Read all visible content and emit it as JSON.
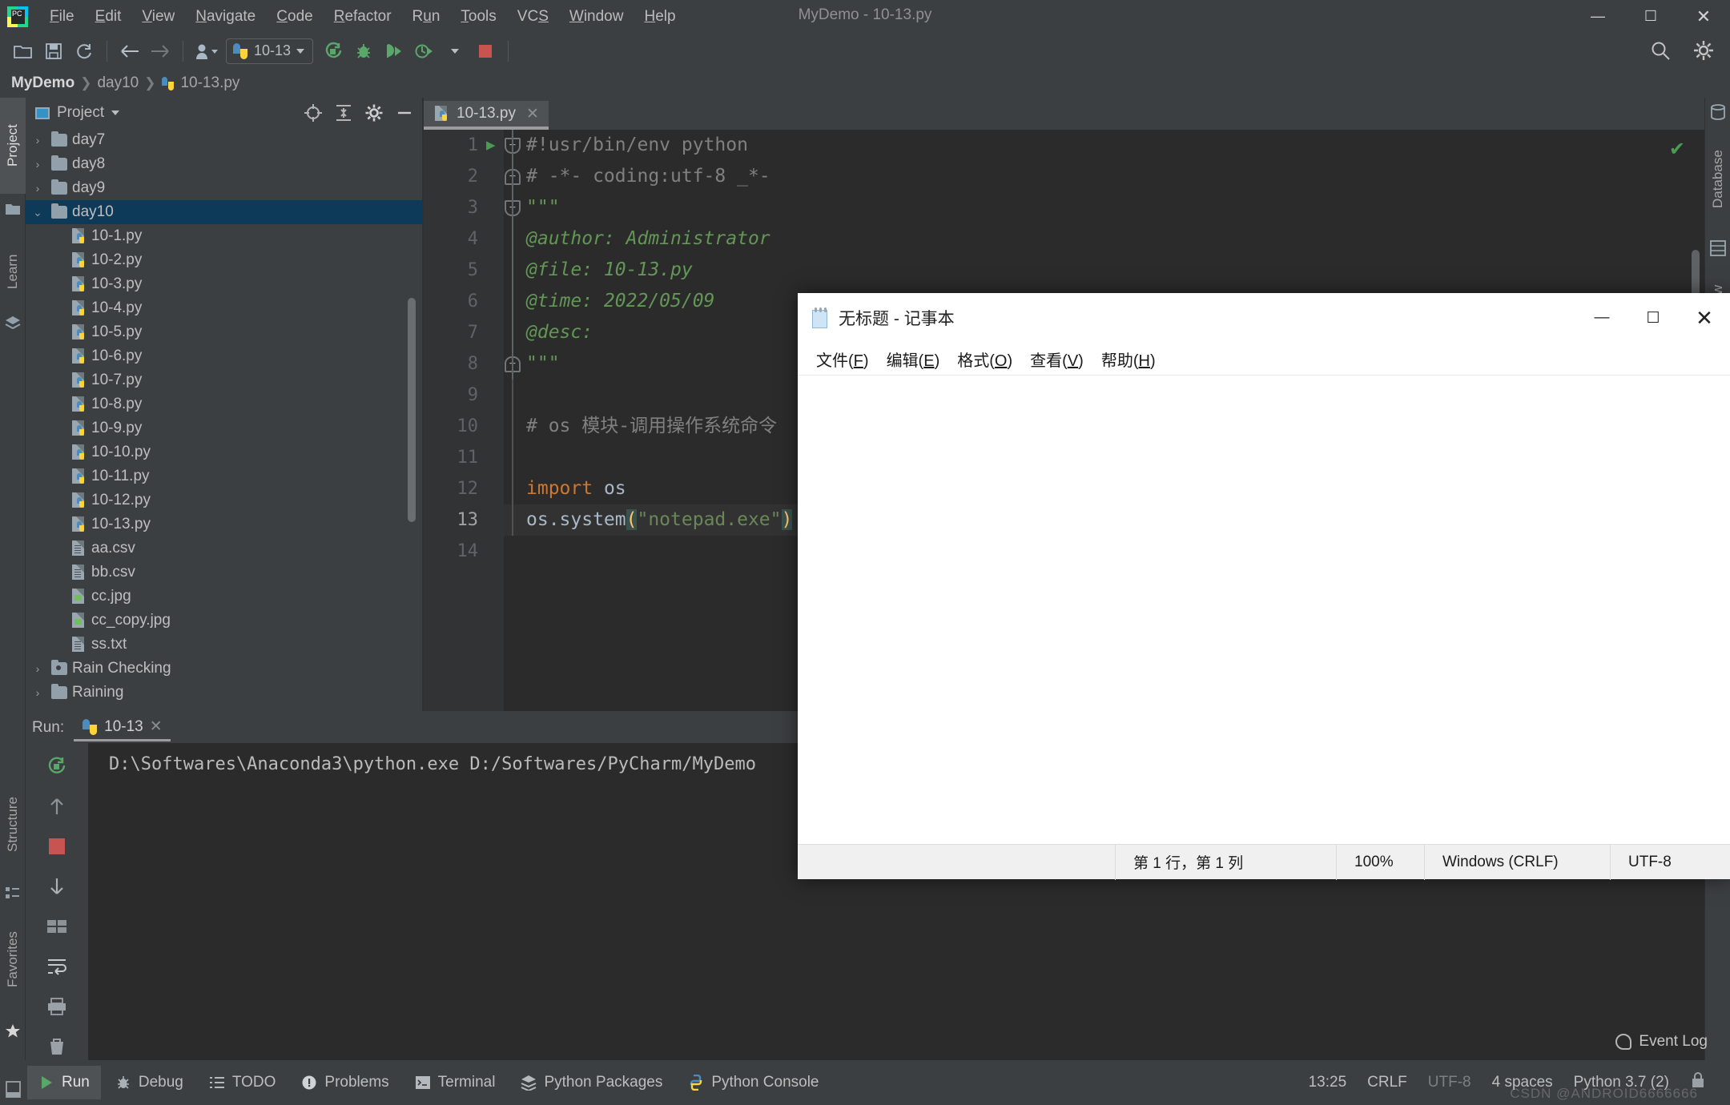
{
  "window": {
    "title": "MyDemo - 10-13.py",
    "minimize": "—",
    "maximize": "☐",
    "close": "✕"
  },
  "menubar": [
    {
      "label": "File",
      "mnemonic": "F"
    },
    {
      "label": "Edit",
      "mnemonic": "E"
    },
    {
      "label": "View",
      "mnemonic": "V"
    },
    {
      "label": "Navigate",
      "mnemonic": "N"
    },
    {
      "label": "Code",
      "mnemonic": "C"
    },
    {
      "label": "Refactor",
      "mnemonic": "R"
    },
    {
      "label": "Run",
      "mnemonic": "u"
    },
    {
      "label": "Tools",
      "mnemonic": "T"
    },
    {
      "label": "VCS",
      "mnemonic": "S"
    },
    {
      "label": "Window",
      "mnemonic": "W"
    },
    {
      "label": "Help",
      "mnemonic": "H"
    }
  ],
  "toolbar": {
    "open_icon": "open-folder-icon",
    "save_icon": "save-icon",
    "sync_icon": "sync-icon",
    "back_icon": "back-arrow-icon",
    "forward_icon": "forward-arrow-icon",
    "profile_icon": "user-icon",
    "run_config": "10-13",
    "run_icon": "run-icon",
    "debug_icon": "debug-icon",
    "coverage_icon": "run-coverage-icon",
    "profile_run_icon": "profile-icon",
    "stop_icon": "stop-icon",
    "search_icon": "search-icon",
    "settings_icon": "gear-icon"
  },
  "breadcrumb": [
    "MyDemo",
    "day10",
    "10-13.py"
  ],
  "left_tool_tabs": [
    {
      "label": "Project",
      "selected": true
    },
    {
      "label": "Learn",
      "selected": false
    },
    {
      "label": "Structure",
      "selected": false
    },
    {
      "label": "Favorites",
      "selected": false
    }
  ],
  "right_tool_tabs": [
    {
      "label": "Database"
    },
    {
      "label": "SciView"
    }
  ],
  "project_panel": {
    "title": "Project",
    "locate_icon": "locate-crosshair-icon",
    "collapse_icon": "collapse-all-icon",
    "settings_icon": "gear-icon",
    "hide_icon": "minimize-icon",
    "tree": [
      {
        "label": "day7",
        "type": "folder",
        "indent": 0,
        "arrow": "›",
        "selected": false
      },
      {
        "label": "day8",
        "type": "folder",
        "indent": 0,
        "arrow": "›",
        "selected": false
      },
      {
        "label": "day9",
        "type": "folder",
        "indent": 0,
        "arrow": "›",
        "selected": false
      },
      {
        "label": "day10",
        "type": "folder",
        "indent": 0,
        "arrow": "⌄",
        "selected": true
      },
      {
        "label": "10-1.py",
        "type": "py",
        "indent": 1,
        "arrow": "",
        "selected": false
      },
      {
        "label": "10-2.py",
        "type": "py",
        "indent": 1,
        "arrow": "",
        "selected": false
      },
      {
        "label": "10-3.py",
        "type": "py",
        "indent": 1,
        "arrow": "",
        "selected": false
      },
      {
        "label": "10-4.py",
        "type": "py",
        "indent": 1,
        "arrow": "",
        "selected": false
      },
      {
        "label": "10-5.py",
        "type": "py",
        "indent": 1,
        "arrow": "",
        "selected": false
      },
      {
        "label": "10-6.py",
        "type": "py",
        "indent": 1,
        "arrow": "",
        "selected": false
      },
      {
        "label": "10-7.py",
        "type": "py",
        "indent": 1,
        "arrow": "",
        "selected": false
      },
      {
        "label": "10-8.py",
        "type": "py",
        "indent": 1,
        "arrow": "",
        "selected": false
      },
      {
        "label": "10-9.py",
        "type": "py",
        "indent": 1,
        "arrow": "",
        "selected": false
      },
      {
        "label": "10-10.py",
        "type": "py",
        "indent": 1,
        "arrow": "",
        "selected": false
      },
      {
        "label": "10-11.py",
        "type": "py",
        "indent": 1,
        "arrow": "",
        "selected": false
      },
      {
        "label": "10-12.py",
        "type": "py",
        "indent": 1,
        "arrow": "",
        "selected": false
      },
      {
        "label": "10-13.py",
        "type": "py",
        "indent": 1,
        "arrow": "",
        "selected": false
      },
      {
        "label": "aa.csv",
        "type": "txt",
        "indent": 1,
        "arrow": "",
        "selected": false
      },
      {
        "label": "bb.csv",
        "type": "txt",
        "indent": 1,
        "arrow": "",
        "selected": false
      },
      {
        "label": "cc.jpg",
        "type": "img",
        "indent": 1,
        "arrow": "",
        "selected": false
      },
      {
        "label": "cc_copy.jpg",
        "type": "img",
        "indent": 1,
        "arrow": "",
        "selected": false
      },
      {
        "label": "ss.txt",
        "type": "txt",
        "indent": 1,
        "arrow": "",
        "selected": false
      },
      {
        "label": "Rain Checking",
        "type": "folder-src",
        "indent": 0,
        "arrow": "›",
        "selected": false
      },
      {
        "label": "Raining",
        "type": "folder",
        "indent": 0,
        "arrow": "›",
        "selected": false
      }
    ]
  },
  "editor": {
    "tab": {
      "label": "10-13.py",
      "close": "✕",
      "icon": "python-file-icon"
    },
    "inspection_status": "✔",
    "lines": [
      {
        "n": "1",
        "fold": "d",
        "run": true,
        "segments": [
          {
            "t": "#!usr/bin/env python",
            "c": "c-comment"
          }
        ]
      },
      {
        "n": "2",
        "fold": "u",
        "run": false,
        "segments": [
          {
            "t": "# -*- coding:utf-8 _*-",
            "c": "c-comment"
          }
        ]
      },
      {
        "n": "3",
        "fold": "d",
        "run": false,
        "segments": [
          {
            "t": "\"\"\"",
            "c": "c-doc"
          }
        ]
      },
      {
        "n": "4",
        "fold": "",
        "run": false,
        "segments": [
          {
            "t": "@author: Administrator",
            "c": "c-doc"
          }
        ]
      },
      {
        "n": "5",
        "fold": "",
        "run": false,
        "segments": [
          {
            "t": "@file: 10-13.py",
            "c": "c-doc"
          }
        ]
      },
      {
        "n": "6",
        "fold": "",
        "run": false,
        "segments": [
          {
            "t": "@time: 2022/05/09",
            "c": "c-doc"
          }
        ]
      },
      {
        "n": "7",
        "fold": "",
        "run": false,
        "segments": [
          {
            "t": "@desc:",
            "c": "c-doc"
          }
        ]
      },
      {
        "n": "8",
        "fold": "u",
        "run": false,
        "segments": [
          {
            "t": "\"\"\"",
            "c": "c-doc"
          }
        ]
      },
      {
        "n": "9",
        "fold": "",
        "run": false,
        "segments": []
      },
      {
        "n": "10",
        "fold": "",
        "run": false,
        "segments": [
          {
            "t": "# os 模块-调用操作系统命令",
            "c": "c-comment"
          }
        ]
      },
      {
        "n": "11",
        "fold": "",
        "run": false,
        "segments": []
      },
      {
        "n": "12",
        "fold": "",
        "run": false,
        "segments": [
          {
            "t": "import",
            "c": "c-kw"
          },
          {
            "t": " os",
            "c": "c-plain"
          }
        ]
      },
      {
        "n": "13",
        "fold": "",
        "run": false,
        "caret": true,
        "segments": [
          {
            "t": "os.system",
            "c": "c-plain"
          },
          {
            "t": "(",
            "c": "c-match"
          },
          {
            "t": "\"notepad.exe\"",
            "c": "c-str"
          },
          {
            "t": ")",
            "c": "c-match"
          }
        ]
      },
      {
        "n": "14",
        "fold": "",
        "run": false,
        "segments": []
      }
    ]
  },
  "run_panel": {
    "label": "Run:",
    "tab": {
      "label": "10-13",
      "close": "✕",
      "icon": "python-run-icon"
    },
    "tool_icons": [
      "rerun-icon",
      "scroll-up-icon",
      "stop-icon",
      "scroll-down-icon",
      "thread-dump-icon",
      "soft-wrap-icon",
      "print-icon",
      "clear-all-icon"
    ],
    "console_output": "D:\\Softwares\\Anaconda3\\python.exe D:/Softwares/PyCharm/MyDemo"
  },
  "status_bar": {
    "tabs": [
      {
        "label": "Run",
        "icon": "run-icon",
        "selected": true
      },
      {
        "label": "Debug",
        "icon": "debug-icon",
        "selected": false
      },
      {
        "label": "TODO",
        "icon": "todo-icon",
        "selected": false
      },
      {
        "label": "Problems",
        "icon": "problems-icon",
        "selected": false
      },
      {
        "label": "Terminal",
        "icon": "terminal-icon",
        "selected": false
      },
      {
        "label": "Python Packages",
        "icon": "packages-icon",
        "selected": false
      },
      {
        "label": "Python Console",
        "icon": "python-console-icon",
        "selected": false
      }
    ],
    "event_log": "Event Log",
    "caret_position": "13:25",
    "line_separator": "CRLF",
    "encoding": "UTF-8",
    "indent": "4 spaces",
    "interpreter": "Python 3.7 (2)",
    "lock_icon": "lock-icon"
  },
  "notepad": {
    "title": "无标题 - 记事本",
    "icon": "notepad-icon",
    "minimize": "—",
    "maximize": "☐",
    "close": "✕",
    "menu": [
      "文件(F)",
      "编辑(E)",
      "格式(O)",
      "查看(V)",
      "帮助(H)"
    ],
    "text_content": "",
    "status": {
      "position": "第 1 行，第 1 列",
      "zoom": "100%",
      "line_ending": "Windows (CRLF)",
      "encoding": "UTF-8"
    }
  },
  "watermark": "CSDN @ANDROID6666666"
}
